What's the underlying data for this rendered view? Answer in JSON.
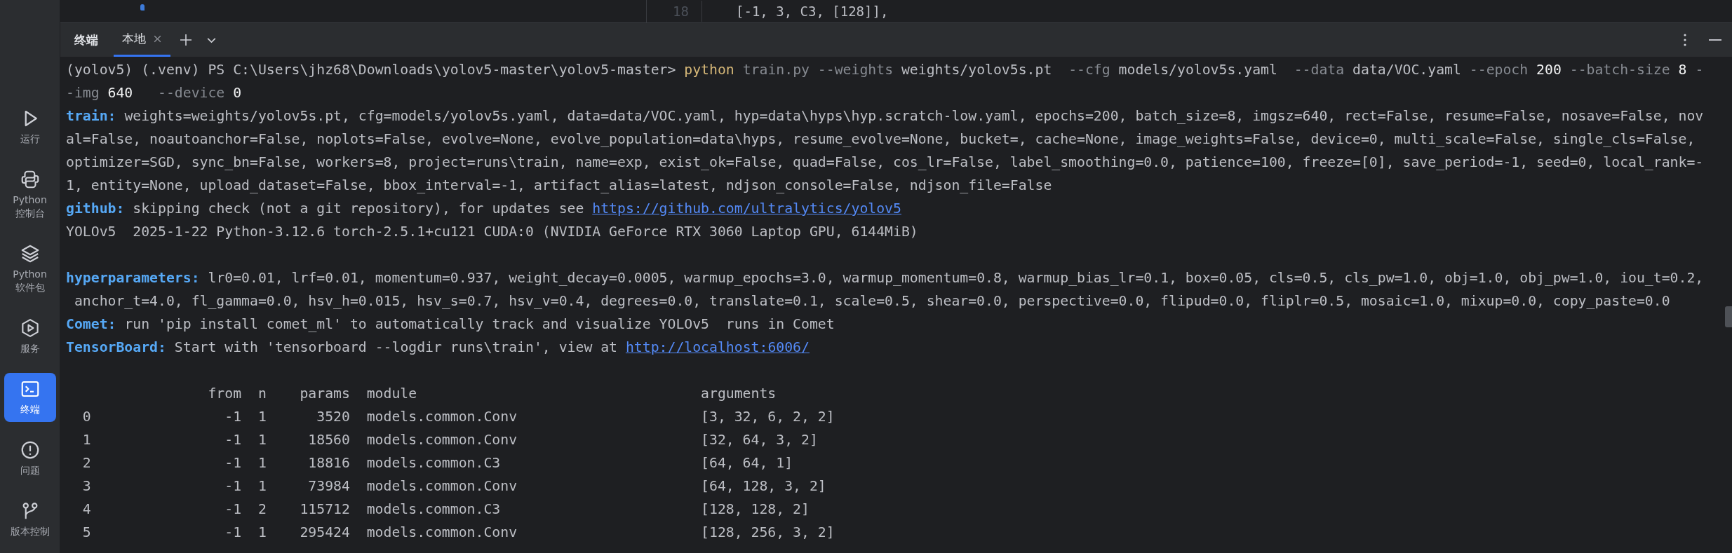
{
  "editor": {
    "line_number": "18",
    "code": "[-1, 3, C3, [128]],"
  },
  "sidebar": {
    "items": [
      {
        "label": "运行",
        "selected": false
      },
      {
        "label": "Python 控制台",
        "selected": false
      },
      {
        "label": "Python 软件包",
        "selected": false
      },
      {
        "label": "服务",
        "selected": false
      },
      {
        "label": "终端",
        "selected": true
      },
      {
        "label": "问题",
        "selected": false
      },
      {
        "label": "版本控制",
        "selected": false
      }
    ]
  },
  "tool_window": {
    "title": "终端",
    "tabs": [
      {
        "label": "本地",
        "selected": true
      }
    ]
  },
  "terminal": {
    "blocks": [
      {
        "lines": [
          {
            "segments": [
              {
                "kind": "prompt",
                "text": "(yolov5) (.venv) PS C:\\Users\\jhz68\\Downloads\\yolov5-master\\yolov5-master>"
              },
              {
                "kind": "command",
                "text": " python"
              },
              {
                "kind": "flag",
                "text": " train.py"
              },
              {
                "kind": "flag",
                "text": " --weights"
              },
              {
                "kind": "arg",
                "text": " weights/yolov5s.pt"
              },
              {
                "kind": "flag",
                "text": "  --cfg"
              },
              {
                "kind": "arg",
                "text": " models/yolov5s.yaml"
              },
              {
                "kind": "flag",
                "text": "  --data"
              },
              {
                "kind": "arg",
                "text": " data/VOC.yaml"
              },
              {
                "kind": "flag",
                "text": " --epoch"
              },
              {
                "kind": "number",
                "text": " 200"
              },
              {
                "kind": "flag",
                "text": " --batch-size"
              },
              {
                "kind": "number",
                "text": " 8"
              },
              {
                "kind": "flag",
                "text": " -"
              }
            ]
          },
          {
            "segments": [
              {
                "kind": "flag",
                "text": "-img"
              },
              {
                "kind": "number",
                "text": " 640"
              },
              {
                "kind": "flag",
                "text": "   --device"
              },
              {
                "kind": "number",
                "text": " 0"
              }
            ]
          },
          {
            "segments": [
              {
                "kind": "label",
                "text": "train:"
              },
              {
                "kind": "text",
                "text": " weights=weights/yolov5s.pt, cfg=models/yolov5s.yaml, data=data/VOC.yaml, hyp=data\\hyps\\hyp.scratch-low.yaml, epochs=200, batch_size=8, imgsz=640, rect=False, resume=False, nosave=False, nov"
              }
            ]
          },
          {
            "segments": [
              {
                "kind": "text",
                "text": "al=False, noautoanchor=False, noplots=False, evolve=None, evolve_population=data\\hyps, resume_evolve=None, bucket=, cache=None, image_weights=False, device=0, multi_scale=False, single_cls=False,"
              }
            ]
          },
          {
            "segments": [
              {
                "kind": "text",
                "text": "optimizer=SGD, sync_bn=False, workers=8, project=runs\\train, name=exp, exist_ok=False, quad=False, cos_lr=False, label_smoothing=0.0, patience=100, freeze=[0], save_period=-1, seed=0, local_rank=-"
              }
            ]
          },
          {
            "segments": [
              {
                "kind": "text",
                "text": "1, entity=None, upload_dataset=False, bbox_interval=-1, artifact_alias=latest, ndjson_console=False, ndjson_file=False"
              }
            ]
          },
          {
            "segments": [
              {
                "kind": "label",
                "text": "github:"
              },
              {
                "kind": "text",
                "text": " skipping check (not a git repository), for updates see "
              },
              {
                "kind": "link",
                "text": "https://github.com/ultralytics/yolov5"
              }
            ]
          },
          {
            "segments": [
              {
                "kind": "text",
                "text": "YOLOv5  2025-1-22 Python-3.12.6 torch-2.5.1+cu121 CUDA:0 (NVIDIA GeForce RTX 3060 Laptop GPU, 6144MiB)"
              }
            ]
          }
        ]
      },
      {
        "lines": [
          {
            "segments": [
              {
                "kind": "label",
                "text": "hyperparameters:"
              },
              {
                "kind": "text",
                "text": " lr0=0.01, lrf=0.01, momentum=0.937, weight_decay=0.0005, warmup_epochs=3.0, warmup_momentum=0.8, warmup_bias_lr=0.1, box=0.05, cls=0.5, cls_pw=1.0, obj=1.0, obj_pw=1.0, iou_t=0.2,"
              }
            ]
          },
          {
            "segments": [
              {
                "kind": "text",
                "text": " anchor_t=4.0, fl_gamma=0.0, hsv_h=0.015, hsv_s=0.7, hsv_v=0.4, degrees=0.0, translate=0.1, scale=0.5, shear=0.0, perspective=0.0, flipud=0.0, fliplr=0.5, mosaic=1.0, mixup=0.0, copy_paste=0.0"
              }
            ]
          },
          {
            "segments": [
              {
                "kind": "label",
                "text": "Comet:"
              },
              {
                "kind": "text",
                "text": " run 'pip install comet_ml' to automatically track and visualize YOLOv5  runs in Comet"
              }
            ]
          },
          {
            "segments": [
              {
                "kind": "label",
                "text": "TensorBoard:"
              },
              {
                "kind": "text",
                "text": " Start with 'tensorboard --logdir runs\\train', view at "
              },
              {
                "kind": "link",
                "text": "http://localhost:6006/"
              }
            ]
          }
        ]
      }
    ],
    "table": {
      "columns": [
        "from",
        "n",
        "params",
        "module",
        "arguments"
      ],
      "rows": [
        {
          "index": "0",
          "from": "-1",
          "n": "1",
          "params": "3520",
          "module": "models.common.Conv",
          "arguments": "[3, 32, 6, 2, 2]"
        },
        {
          "index": "1",
          "from": "-1",
          "n": "1",
          "params": "18560",
          "module": "models.common.Conv",
          "arguments": "[32, 64, 3, 2]"
        },
        {
          "index": "2",
          "from": "-1",
          "n": "1",
          "params": "18816",
          "module": "models.common.C3",
          "arguments": "[64, 64, 1]"
        },
        {
          "index": "3",
          "from": "-1",
          "n": "1",
          "params": "73984",
          "module": "models.common.Conv",
          "arguments": "[64, 128, 3, 2]"
        },
        {
          "index": "4",
          "from": "-1",
          "n": "2",
          "params": "115712",
          "module": "models.common.C3",
          "arguments": "[128, 128, 2]"
        },
        {
          "index": "5",
          "from": "-1",
          "n": "1",
          "params": "295424",
          "module": "models.common.Conv",
          "arguments": "[128, 256, 3, 2]"
        }
      ]
    }
  }
}
